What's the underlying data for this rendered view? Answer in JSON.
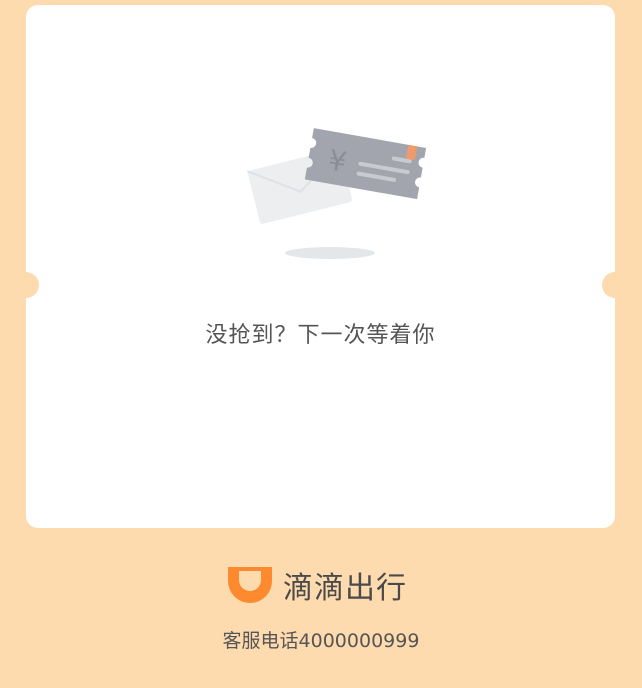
{
  "result": {
    "message": "没抢到？下一次等着你"
  },
  "brand": {
    "name": "滴滴出行",
    "logo_icon": "didi-logo-icon",
    "logo_color": "#fd8a2e"
  },
  "footer": {
    "hotline": "客服电话4000000999"
  },
  "illustration": {
    "icon": "empty-coupon-envelope-icon",
    "currency_symbol": "¥"
  },
  "colors": {
    "background": "#fedbaf",
    "card": "#ffffff",
    "text": "#555555"
  }
}
